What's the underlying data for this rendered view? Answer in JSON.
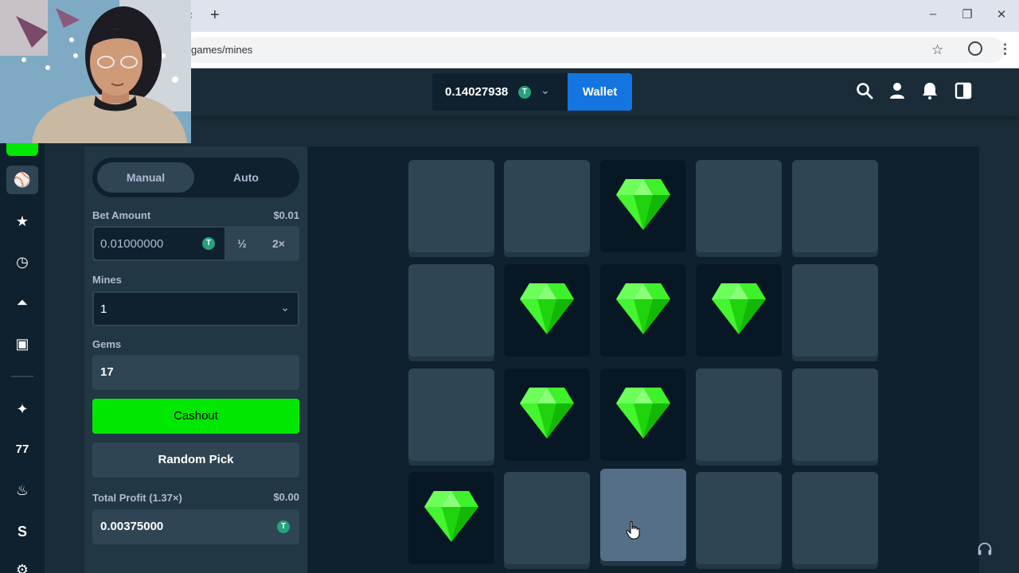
{
  "browser": {
    "url": "games/mines",
    "tab_close": "×",
    "new_tab": "+",
    "minimize": "–",
    "restore": "❐",
    "close": "✕"
  },
  "header": {
    "balance": "0.14027938",
    "currency_symbol": "T",
    "wallet_label": "Wallet"
  },
  "panel": {
    "tabs": {
      "manual": "Manual",
      "auto": "Auto"
    },
    "bet_amount_label": "Bet Amount",
    "bet_amount_usd": "$0.01",
    "bet_amount_value": "0.01000000",
    "half_label": "½",
    "double_label": "2×",
    "mines_label": "Mines",
    "mines_value": "1",
    "gems_label": "Gems",
    "gems_value": "17",
    "cashout_label": "Cashout",
    "random_pick_label": "Random Pick",
    "total_profit_label": "Total Profit (1.37×)",
    "total_profit_usd": "$0.00",
    "total_profit_value": "0.00375000"
  },
  "grid": {
    "rows": [
      [
        "hidden",
        "hidden",
        "gem",
        "hidden",
        "hidden"
      ],
      [
        "hidden",
        "gem",
        "gem",
        "gem",
        "hidden"
      ],
      [
        "hidden",
        "gem",
        "gem",
        "hidden",
        "hidden"
      ],
      [
        "gem",
        "hidden",
        "hover",
        "hidden",
        "hidden"
      ]
    ]
  },
  "colors": {
    "accent_green": "#00e701",
    "wallet_blue": "#1475e1",
    "bg": "#1a2c38",
    "tether": "#26a17b"
  },
  "icons": {
    "header": [
      "search-icon",
      "user-icon",
      "bell-icon",
      "sidebar-toggle-icon"
    ],
    "sidebar": [
      "casino-icon",
      "star-icon",
      "clock-icon",
      "flask-icon",
      "bookmark-icon",
      "sparkle-icon",
      "sevens-icon",
      "fire-icon",
      "stake-icon",
      "gear-icon"
    ]
  }
}
